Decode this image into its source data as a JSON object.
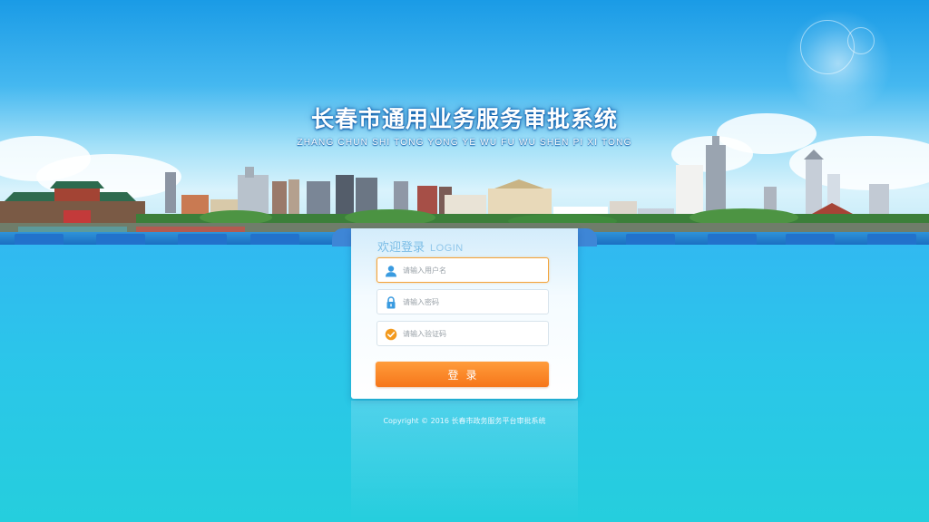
{
  "header": {
    "title_cn": "长春市通用业务服务审批系统",
    "title_en": "ZHANG CHUN SHI TONG YONG YE WU FU WU SHEN PI XI TONG"
  },
  "login": {
    "heading_cn": "欢迎登录",
    "heading_en": "LOGIN",
    "username": {
      "placeholder": "请输入用户名",
      "value": "",
      "icon": "user-icon"
    },
    "password": {
      "placeholder": "请输入密码",
      "value": "",
      "icon": "lock-icon"
    },
    "captcha": {
      "placeholder": "请输入验证码",
      "value": "",
      "icon": "check-circle-icon"
    },
    "submit_label": "登录"
  },
  "footer": {
    "copyright": "Copyright © 2016 长春市政务服务平台审批系统"
  },
  "colors": {
    "accent": "#f6761a",
    "icon_blue": "#3a9be0",
    "icon_orange": "#f39a1e",
    "band": "#1b6fc1"
  }
}
